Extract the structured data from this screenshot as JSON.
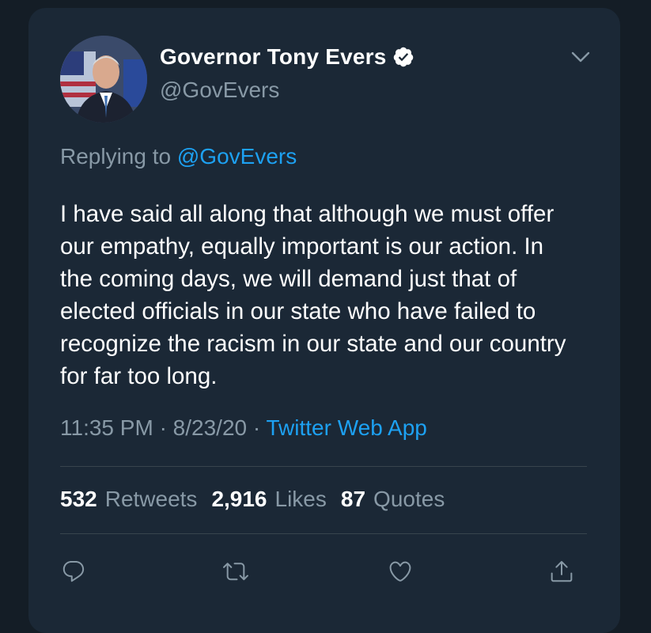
{
  "author": {
    "name": "Governor Tony Evers",
    "handle": "@GovEvers",
    "verified": true
  },
  "reply": {
    "prefix": "Replying to",
    "mention": "@GovEvers"
  },
  "tweet": {
    "text": "I have said all along that although we must offer our empathy, equally important is our action. In the coming days, we will demand just that of elected officials in our state who have failed to recognize the racism in our state and our country for far too long."
  },
  "meta": {
    "time": "11:35 PM",
    "separator1": "·",
    "date": "8/23/20",
    "separator2": "·",
    "source": "Twitter Web App"
  },
  "stats": {
    "retweets_count": "532",
    "retweets_label": "Retweets",
    "likes_count": "2,916",
    "likes_label": "Likes",
    "quotes_count": "87",
    "quotes_label": "Quotes"
  },
  "icons": {
    "verified": "verified-badge-icon",
    "more": "chevron-down-icon",
    "reply": "reply-icon",
    "retweet": "retweet-icon",
    "like": "heart-icon",
    "share": "share-icon"
  },
  "colors": {
    "background": "#141d26",
    "card": "#1b2836",
    "accent": "#1da1f2",
    "secondary_text": "#8899a6"
  }
}
